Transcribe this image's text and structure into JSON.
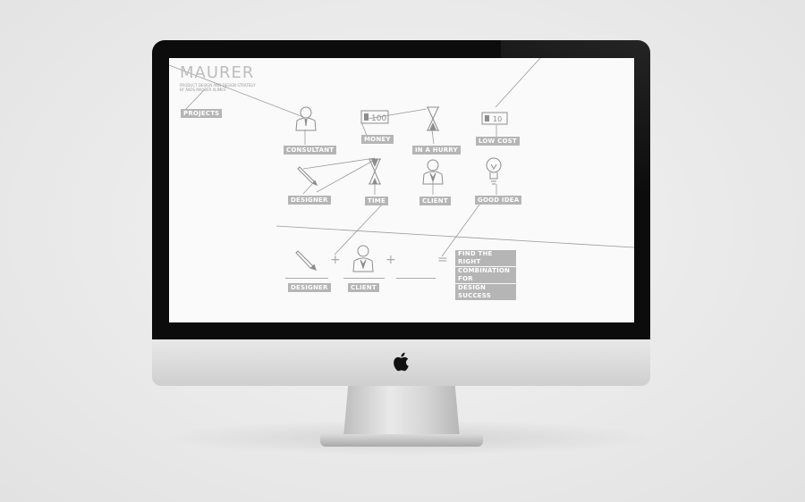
{
  "site": {
    "brand": "MAURER",
    "tagline": "PRODUCT DESIGN AND DESIGN STRATEGY BY ÁKOS MAURER KLIMES",
    "nav_projects": "PROJECTS"
  },
  "nodes": {
    "consultant": "CONSULTANT",
    "money": "MONEY",
    "in_a_hurry": "IN A HURRY",
    "low_cost": "LOW COST",
    "designer": "DESIGNER",
    "time": "TIME",
    "client": "CLIENT",
    "good_idea": "GOOD IDEA"
  },
  "money_icon_text": "100",
  "low_cost_icon_text": "10",
  "equation": {
    "designer": "DESIGNER",
    "client": "CLIENT",
    "plus": "+",
    "equals": "=",
    "result_lines": [
      "FIND THE RIGHT",
      "COMBINATION FOR",
      "DESIGN SUCCESS"
    ]
  },
  "colors": {
    "label_bg": "#b5b5b5",
    "line": "#9a9a9a",
    "screen_bg": "#fafafa",
    "bezel": "#0c0c0c"
  }
}
